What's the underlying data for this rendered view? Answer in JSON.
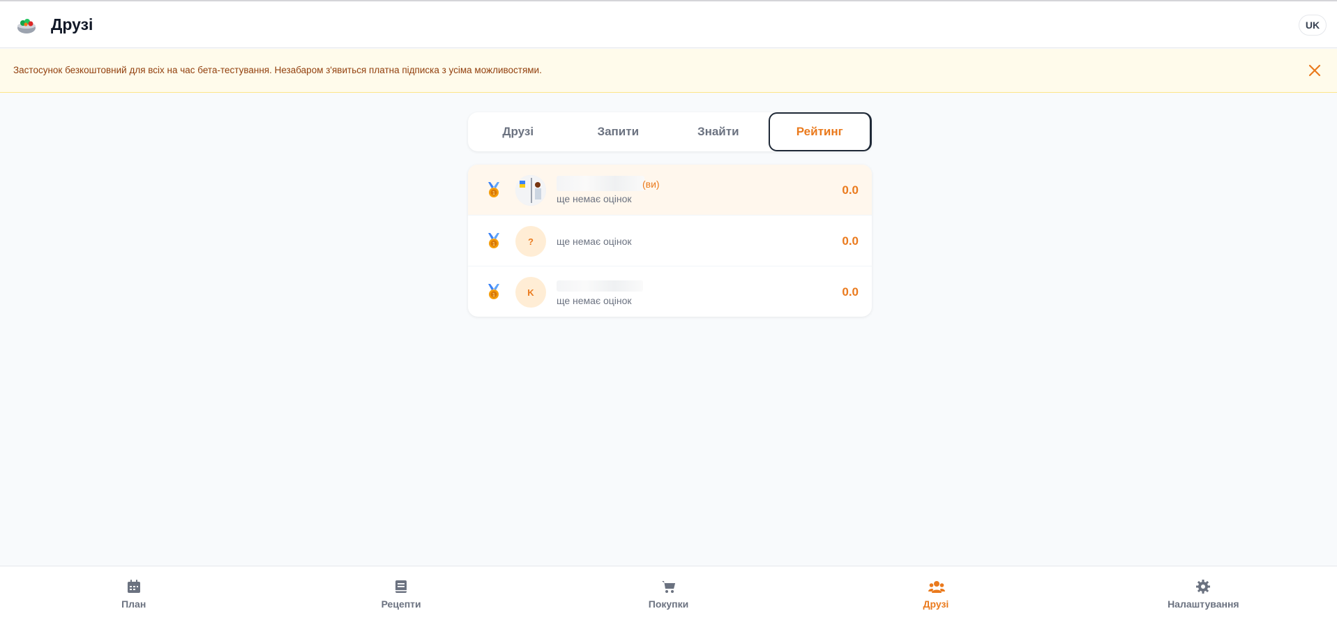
{
  "header": {
    "title": "Друзі",
    "language": "UK",
    "logo_icon": "salad-bowl-icon"
  },
  "banner": {
    "text": "Застосунок безкоштовний для всіх на час бета-тестування. Незабаром з'явиться платна підписка з усіма можливостями.",
    "close_icon": "close-icon",
    "color": "#92400e"
  },
  "tabs": [
    {
      "label": "Друзі",
      "active": false
    },
    {
      "label": "Запити",
      "active": false
    },
    {
      "label": "Знайти",
      "active": false
    },
    {
      "label": "Рейтинг",
      "active": true
    }
  ],
  "ranking": [
    {
      "avatar": "photo",
      "you_suffix": "(ви)",
      "subtitle": "ще немає оцінок",
      "score": "0.0",
      "medal_icon": "medal-icon"
    },
    {
      "avatar": "?",
      "subtitle": "ще немає оцінок",
      "score": "0.0",
      "medal_icon": "medal-icon"
    },
    {
      "avatar": "K",
      "subtitle": "ще немає оцінок",
      "score": "0.0",
      "medal_icon": "medal-icon"
    }
  ],
  "bottom_nav": [
    {
      "label": "План",
      "icon": "calendar-icon",
      "active": false
    },
    {
      "label": "Рецепти",
      "icon": "book-icon",
      "active": false
    },
    {
      "label": "Покупки",
      "icon": "cart-icon",
      "active": false
    },
    {
      "label": "Друзі",
      "icon": "users-icon",
      "active": true
    },
    {
      "label": "Налаштування",
      "icon": "gear-icon",
      "active": false
    }
  ],
  "colors": {
    "accent": "#ea7a1d",
    "banner_bg": "#fffbeb",
    "highlight_row": "#fff7ed"
  }
}
